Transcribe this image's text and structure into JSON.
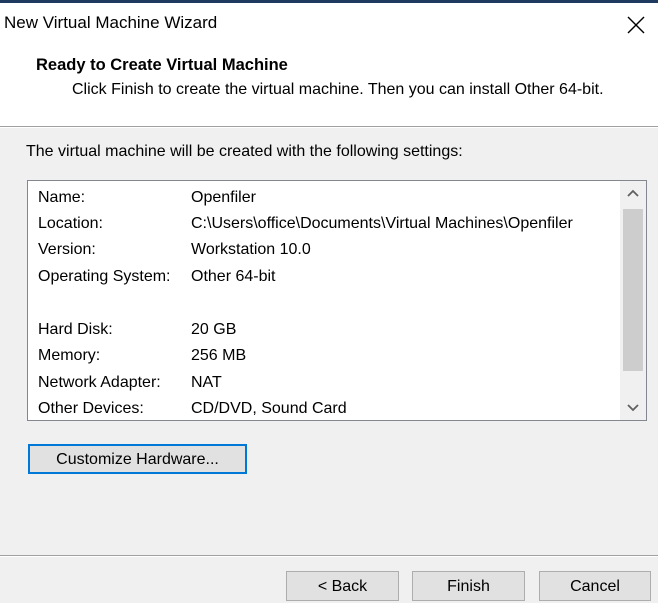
{
  "window": {
    "title": "New Virtual Machine Wizard"
  },
  "header": {
    "title": "Ready to Create Virtual Machine",
    "description": "Click Finish to create the virtual machine. Then you can install Other 64-bit."
  },
  "body": {
    "intro": "The virtual machine will be created with the following settings:",
    "settings": [
      {
        "key": "Name:",
        "value": "Openfiler"
      },
      {
        "key": "Location:",
        "value": "C:\\Users\\office\\Documents\\Virtual Machines\\Openfiler"
      },
      {
        "key": "Version:",
        "value": "Workstation 10.0"
      },
      {
        "key": "Operating System:",
        "value": "Other 64-bit"
      },
      {
        "key": "",
        "value": ""
      },
      {
        "key": "Hard Disk:",
        "value": "20 GB"
      },
      {
        "key": "Memory:",
        "value": "256 MB"
      },
      {
        "key": "Network Adapter:",
        "value": "NAT"
      },
      {
        "key": "Other Devices:",
        "value": "CD/DVD, Sound Card"
      }
    ],
    "customize_label": "Customize Hardware..."
  },
  "footer": {
    "back_label": "< Back",
    "finish_label": "Finish",
    "cancel_label": "Cancel"
  },
  "icons": {
    "close": "close-icon",
    "scroll_up": "chevron-up-icon",
    "scroll_down": "chevron-down-icon"
  },
  "colors": {
    "accent": "#0078d7",
    "panel": "#f0f0f0",
    "button": "#e1e1e1"
  }
}
